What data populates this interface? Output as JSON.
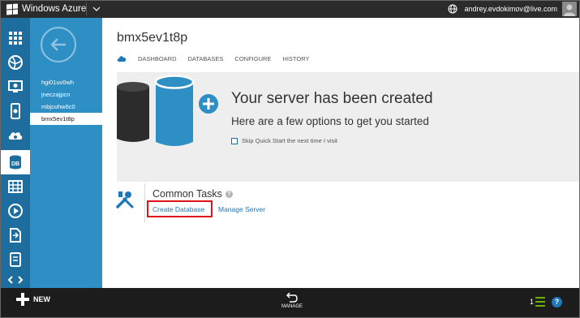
{
  "app": {
    "title": "Windows Azure"
  },
  "user": {
    "email": "andrey.evdokimov@live.com"
  },
  "rail": {
    "items": [
      {
        "icon": "all-items-grid-icon"
      },
      {
        "icon": "web-sites-icon"
      },
      {
        "icon": "virtual-machines-icon"
      },
      {
        "icon": "mobile-services-icon"
      },
      {
        "icon": "cloud-services-icon"
      },
      {
        "icon": "sql-databases-icon",
        "label": "DB",
        "active": true
      },
      {
        "icon": "storage-icon"
      },
      {
        "icon": "media-services-icon"
      },
      {
        "icon": "service-bus-icon"
      },
      {
        "icon": "mobile-device-icon"
      },
      {
        "icon": "code-icon"
      }
    ]
  },
  "subnav": {
    "items": [
      {
        "label": "hgi01uv0wh"
      },
      {
        "label": "jneczajpcn"
      },
      {
        "label": "mbjcohw6c0"
      },
      {
        "label": "bmx5ev1t8p",
        "active": true
      }
    ]
  },
  "main": {
    "title": "bmx5ev1t8p",
    "tabs": [
      {
        "label": "DASHBOARD"
      },
      {
        "label": "DATABASES"
      },
      {
        "label": "CONFIGURE"
      },
      {
        "label": "HISTORY"
      }
    ]
  },
  "banner": {
    "heading": "Your server has been created",
    "subheading": "Here are a few options to get you started",
    "skip_label": "Skip Quick Start the next time I visit"
  },
  "tasks": {
    "title": "Common Tasks",
    "help_glyph": "?",
    "links": [
      {
        "label": "Create Database"
      },
      {
        "label": "Manage Server"
      }
    ]
  },
  "bottombar": {
    "new_label": "NEW",
    "manage_label": "MANAGE",
    "count": "1",
    "help_glyph": "?"
  },
  "colors": {
    "accent_blue": "#2e8fc5",
    "rail_blue": "#1d6e9e",
    "link_blue": "#1e77b7",
    "highlight_red": "#e0131a",
    "top_bar": "#2b2b2b",
    "bottom_bar": "#1c1c1c"
  }
}
